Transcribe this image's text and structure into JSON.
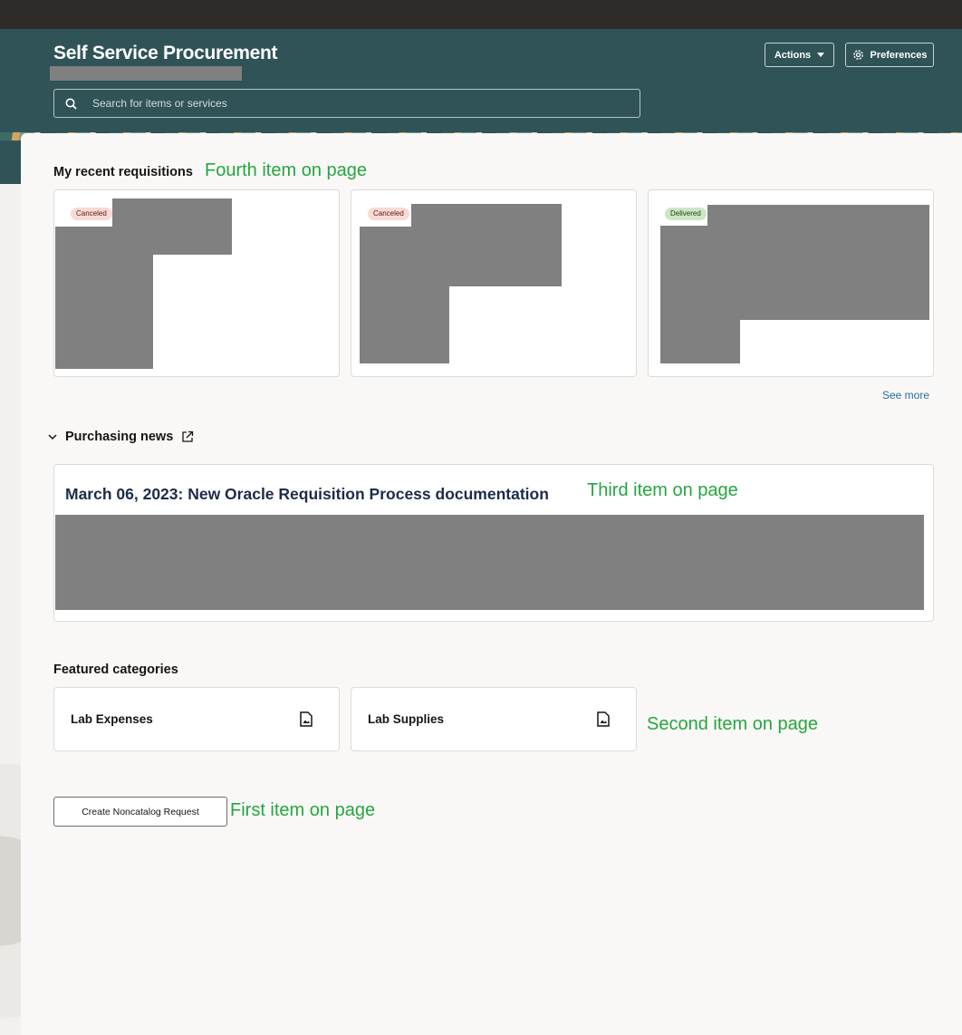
{
  "header": {
    "title": "Self Service Procurement",
    "search_placeholder": "Search for items or services",
    "actions_label": "Actions",
    "preferences_label": "Preferences"
  },
  "recent_requisitions": {
    "title": "My recent requisitions",
    "annotation": "Fourth item on page",
    "cards": [
      {
        "status": "Canceled"
      },
      {
        "status": "Canceled"
      },
      {
        "status": "Delivered"
      }
    ],
    "see_more": "See more"
  },
  "purchasing_news": {
    "title": "Purchasing news",
    "item_title": "March 06, 2023: New Oracle Requisition Process documentation",
    "annotation": "Third item on page"
  },
  "featured_categories": {
    "title": "Featured categories",
    "items": [
      {
        "label": "Lab Expenses",
        "icon": "image-file-icon"
      },
      {
        "label": "Lab Supplies",
        "icon": "image-file-icon"
      }
    ],
    "annotation": "Second item on page"
  },
  "noncatalog": {
    "button_label": "Create Noncatalog Request",
    "annotation": "First item on page"
  },
  "colors": {
    "header_bg": "#2f5357",
    "topbar_bg": "#2e2b28",
    "annotation": "#26a541",
    "link": "#2a6b9e"
  }
}
